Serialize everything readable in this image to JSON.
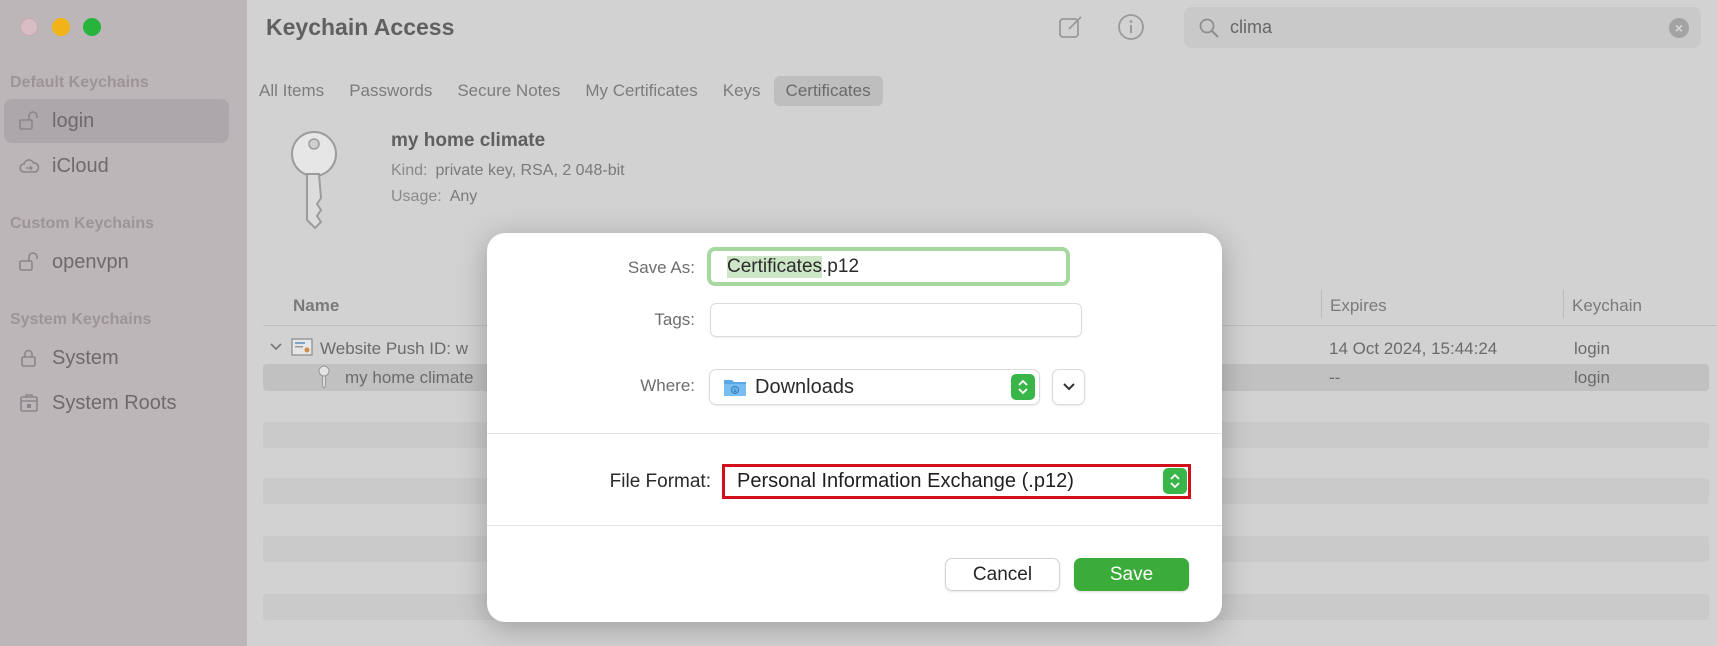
{
  "window": {
    "title": "Keychain Access"
  },
  "sidebar": {
    "sections": [
      {
        "label": "Default Keychains"
      },
      {
        "label": "Custom Keychains"
      },
      {
        "label": "System Keychains"
      }
    ],
    "items": [
      {
        "label": "login",
        "icon": "unlocked-padlock-icon",
        "selected": true
      },
      {
        "label": "iCloud",
        "icon": "cloud-icon"
      },
      {
        "label": "openvpn",
        "icon": "unlocked-padlock-icon"
      },
      {
        "label": "System",
        "icon": "locked-padlock-icon"
      },
      {
        "label": "System Roots",
        "icon": "cabinet-icon"
      }
    ]
  },
  "toolbar": {
    "search_value": "clima",
    "icons": [
      "compose-icon",
      "info-icon",
      "search-icon",
      "clear-icon"
    ]
  },
  "tabs": [
    {
      "label": "All Items"
    },
    {
      "label": "Passwords"
    },
    {
      "label": "Secure Notes"
    },
    {
      "label": "My Certificates"
    },
    {
      "label": "Keys"
    },
    {
      "label": "Certificates",
      "active": true
    }
  ],
  "detail": {
    "name": "my home climate",
    "kind_label": "Kind:",
    "kind_value": "private key, RSA, 2 048-bit",
    "usage_label": "Usage:",
    "usage_value": "Any"
  },
  "table": {
    "headers": {
      "name": "Name",
      "expires": "Expires",
      "keychain": "Keychain"
    },
    "rows": [
      {
        "name": "Website Push ID: w",
        "expires": "14 Oct 2024, 15:44:24",
        "keychain": "login"
      },
      {
        "name": "my home climate",
        "expires": "--",
        "keychain": "login",
        "selected": true
      }
    ]
  },
  "dialog": {
    "save_as_label": "Save As:",
    "save_as_name": "Certificates",
    "save_as_ext": ".p12",
    "tags_label": "Tags:",
    "tags_value": "",
    "where_label": "Where:",
    "where_value": "Downloads",
    "file_format_label": "File Format:",
    "file_format_value": "Personal Information Exchange (.p12)",
    "cancel_label": "Cancel",
    "save_label": "Save"
  },
  "colors": {
    "accent_green": "#3bab3a",
    "highlight_red": "#d0111b",
    "focus_ring": "#a7d8a0"
  }
}
